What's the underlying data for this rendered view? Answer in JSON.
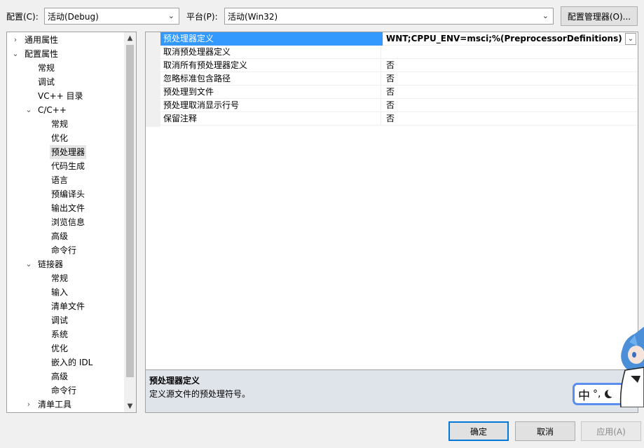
{
  "toolbar": {
    "config_label": "配置(C):",
    "config_value": "活动(Debug)",
    "platform_label": "平台(P):",
    "platform_value": "活动(Win32)",
    "config_manager_button": "配置管理器(O)..."
  },
  "tree": {
    "items": [
      {
        "label": "通用属性",
        "level": 0,
        "twisty": "›"
      },
      {
        "label": "配置属性",
        "level": 0,
        "twisty": "⌄"
      },
      {
        "label": "常规",
        "level": 1,
        "twisty": ""
      },
      {
        "label": "调试",
        "level": 1,
        "twisty": ""
      },
      {
        "label": "VC++ 目录",
        "level": 1,
        "twisty": ""
      },
      {
        "label": "C/C++",
        "level": 1,
        "twisty": "⌄"
      },
      {
        "label": "常规",
        "level": 2,
        "twisty": ""
      },
      {
        "label": "优化",
        "level": 2,
        "twisty": ""
      },
      {
        "label": "预处理器",
        "level": 2,
        "twisty": "",
        "selected": true
      },
      {
        "label": "代码生成",
        "level": 2,
        "twisty": ""
      },
      {
        "label": "语言",
        "level": 2,
        "twisty": ""
      },
      {
        "label": "预编译头",
        "level": 2,
        "twisty": ""
      },
      {
        "label": "输出文件",
        "level": 2,
        "twisty": ""
      },
      {
        "label": "浏览信息",
        "level": 2,
        "twisty": ""
      },
      {
        "label": "高级",
        "level": 2,
        "twisty": ""
      },
      {
        "label": "命令行",
        "level": 2,
        "twisty": ""
      },
      {
        "label": "链接器",
        "level": 1,
        "twisty": "⌄"
      },
      {
        "label": "常规",
        "level": 2,
        "twisty": ""
      },
      {
        "label": "输入",
        "level": 2,
        "twisty": ""
      },
      {
        "label": "清单文件",
        "level": 2,
        "twisty": ""
      },
      {
        "label": "调试",
        "level": 2,
        "twisty": ""
      },
      {
        "label": "系统",
        "level": 2,
        "twisty": ""
      },
      {
        "label": "优化",
        "level": 2,
        "twisty": ""
      },
      {
        "label": "嵌入的 IDL",
        "level": 2,
        "twisty": ""
      },
      {
        "label": "高级",
        "level": 2,
        "twisty": ""
      },
      {
        "label": "命令行",
        "level": 2,
        "twisty": ""
      },
      {
        "label": "清单工具",
        "level": 1,
        "twisty": "›"
      }
    ]
  },
  "properties": [
    {
      "name": "预处理器定义",
      "value": "WNT;CPPU_ENV=msci;%(PreprocessorDefinitions)",
      "selected": true
    },
    {
      "name": "取消预处理器定义",
      "value": ""
    },
    {
      "name": "取消所有预处理器定义",
      "value": "否"
    },
    {
      "name": "忽略标准包含路径",
      "value": "否"
    },
    {
      "name": "预处理到文件",
      "value": "否"
    },
    {
      "name": "预处理取消显示行号",
      "value": "否"
    },
    {
      "name": "保留注释",
      "value": "否"
    }
  ],
  "description": {
    "title": "预处理器定义",
    "text": "定义源文件的预处理符号。"
  },
  "ime": {
    "mode": "中",
    "punct": "°,"
  },
  "buttons": {
    "ok": "确定",
    "cancel": "取消",
    "apply": "应用(A)"
  },
  "colors": {
    "selection": "#3399ff",
    "accent": "#0078d7"
  }
}
